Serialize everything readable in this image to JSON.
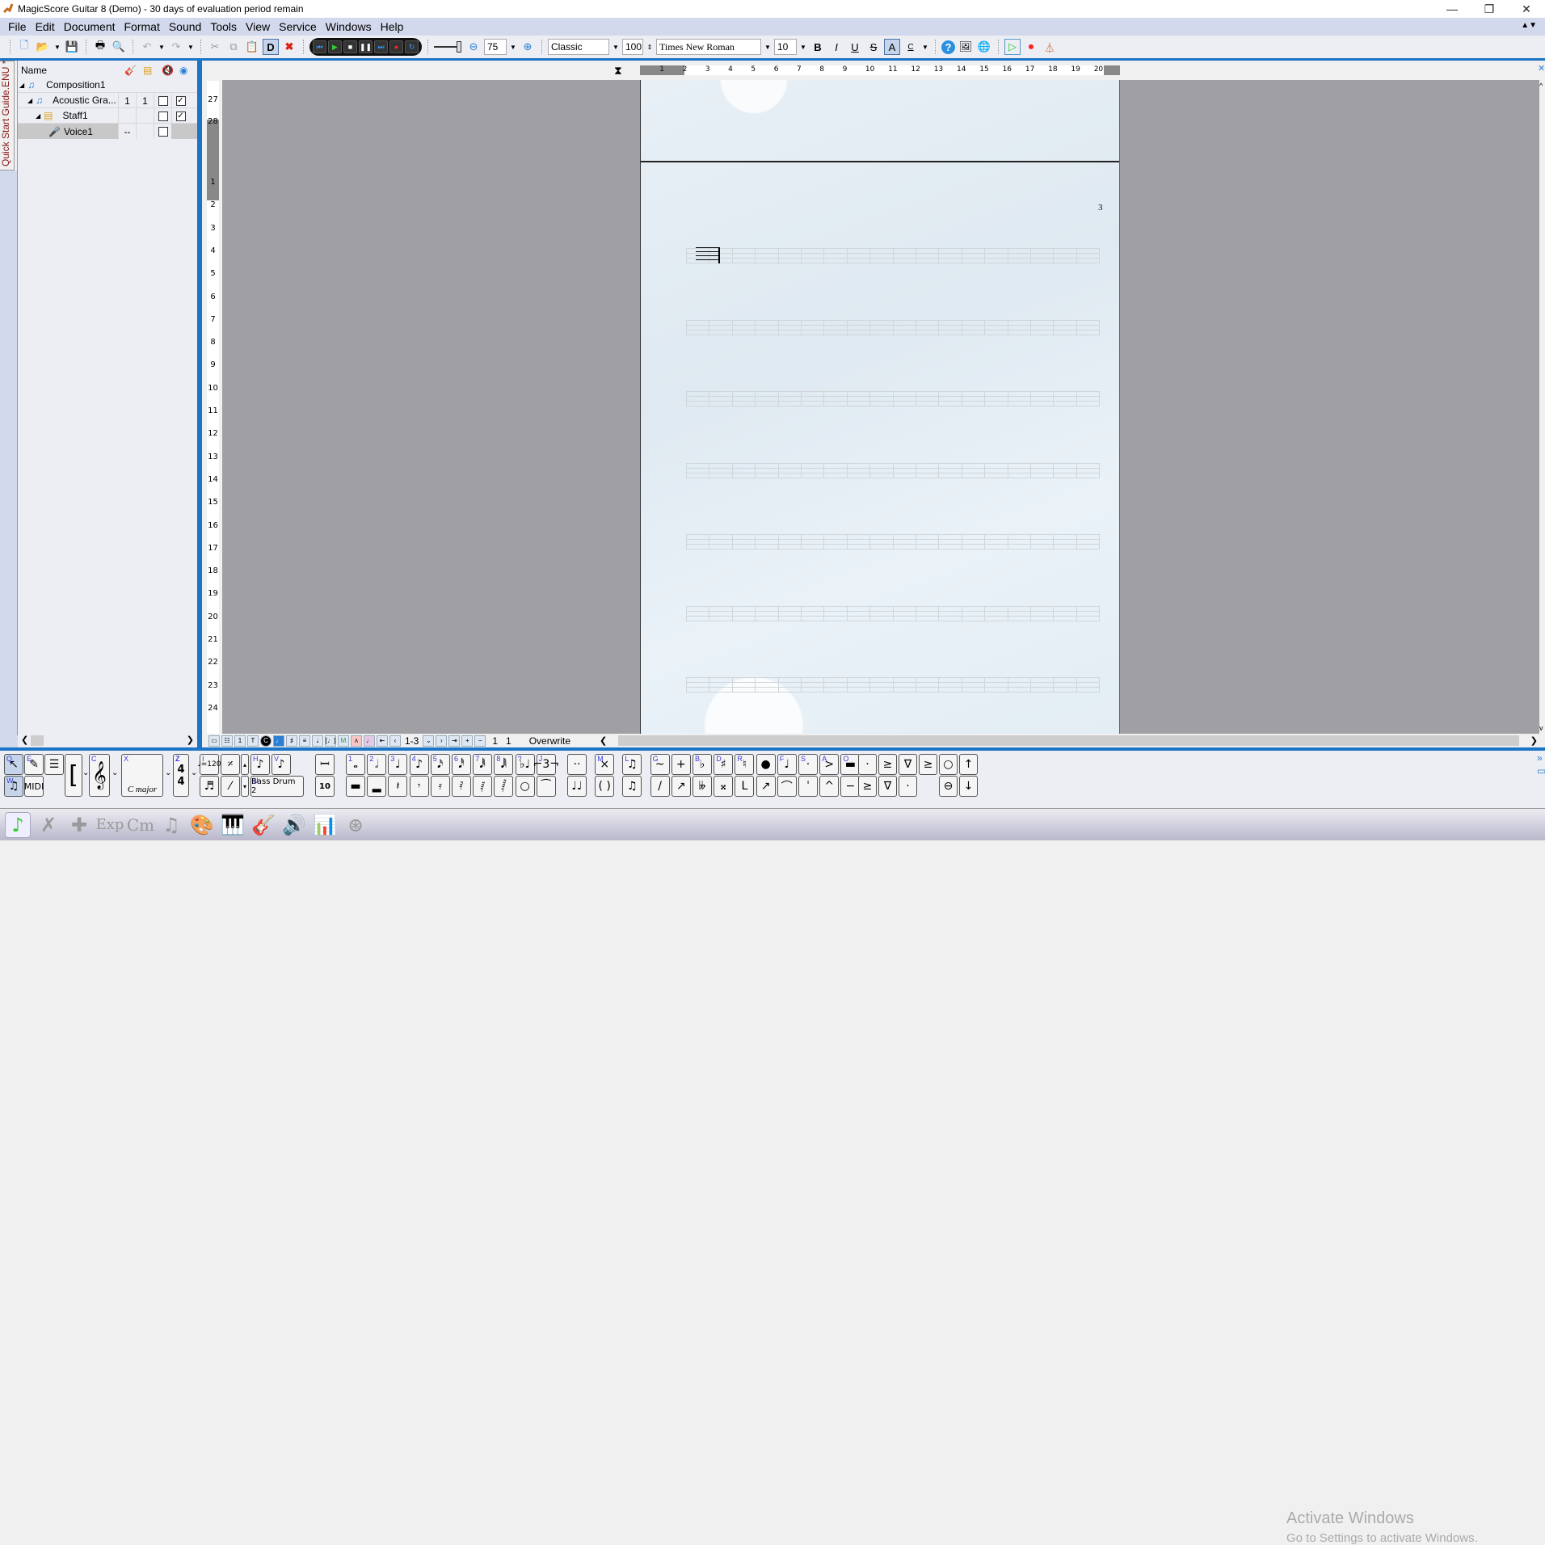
{
  "window": {
    "title": "MagicScore Guitar 8 (Demo) - 30 days of evaluation period remain",
    "minimize": "—",
    "restore": "❐",
    "close": "✕"
  },
  "menu": [
    "File",
    "Edit",
    "Document",
    "Format",
    "Sound",
    "Tools",
    "View",
    "Service",
    "Windows",
    "Help"
  ],
  "toolbar": {
    "zoom_value": "75",
    "style_value": "Classic",
    "size_value": "100",
    "font_value": "Times New Roman",
    "font_size_value": "10",
    "bold": "B",
    "italic": "I",
    "underline": "U",
    "strike": "S",
    "font_color": "A",
    "text_color": "C",
    "d_button": "D"
  },
  "sidebar": {
    "quick_start_tab": "Quick Start Guide.ENU *",
    "header": {
      "name": "Name"
    },
    "rows": [
      {
        "label": "Composition1",
        "c1": "",
        "c2": "",
        "c3": "",
        "c4": ""
      },
      {
        "label": "Acoustic Gra...",
        "c1": "1",
        "c2": "1",
        "c3": "unchecked",
        "c4": "checked"
      },
      {
        "label": "Staff1",
        "c1": "",
        "c2": "",
        "c3": "unchecked",
        "c4": "checked"
      },
      {
        "label": "Voice1",
        "c1": "--",
        "c2": "",
        "c3": "unchecked",
        "c4": ""
      }
    ]
  },
  "ruler": {
    "horizontal": [
      "1",
      "2",
      "3",
      "4",
      "5",
      "6",
      "7",
      "8",
      "9",
      "10",
      "11",
      "12",
      "13",
      "14",
      "15",
      "16",
      "17",
      "18",
      "19",
      "20"
    ],
    "vertical": [
      "27",
      "28",
      "1",
      "2",
      "3",
      "4",
      "5",
      "6",
      "7",
      "8",
      "9",
      "10",
      "11",
      "12",
      "13",
      "14",
      "15",
      "16",
      "17",
      "18",
      "19",
      "20",
      "21",
      "22",
      "23",
      "24"
    ]
  },
  "page": {
    "page_number": "3",
    "staff_count": 7
  },
  "statusbar": {
    "page_range": "1-3",
    "pos1": "1",
    "pos2": "1",
    "mode": "Overwrite"
  },
  "palette": {
    "key_label": "C major",
    "tempo": "=120",
    "instrument": "Bass Drum 2",
    "measure_num": "10",
    "midi": "MIDI"
  },
  "watermark": {
    "line1": "Activate Windows",
    "line2": "Go to Settings to activate Windows."
  },
  "tabs": [
    "notes",
    "cross-tools",
    "add-tools",
    "Exp",
    "Cm",
    "music",
    "palette",
    "piano",
    "guitar",
    "speaker",
    "mixer",
    "compass"
  ]
}
